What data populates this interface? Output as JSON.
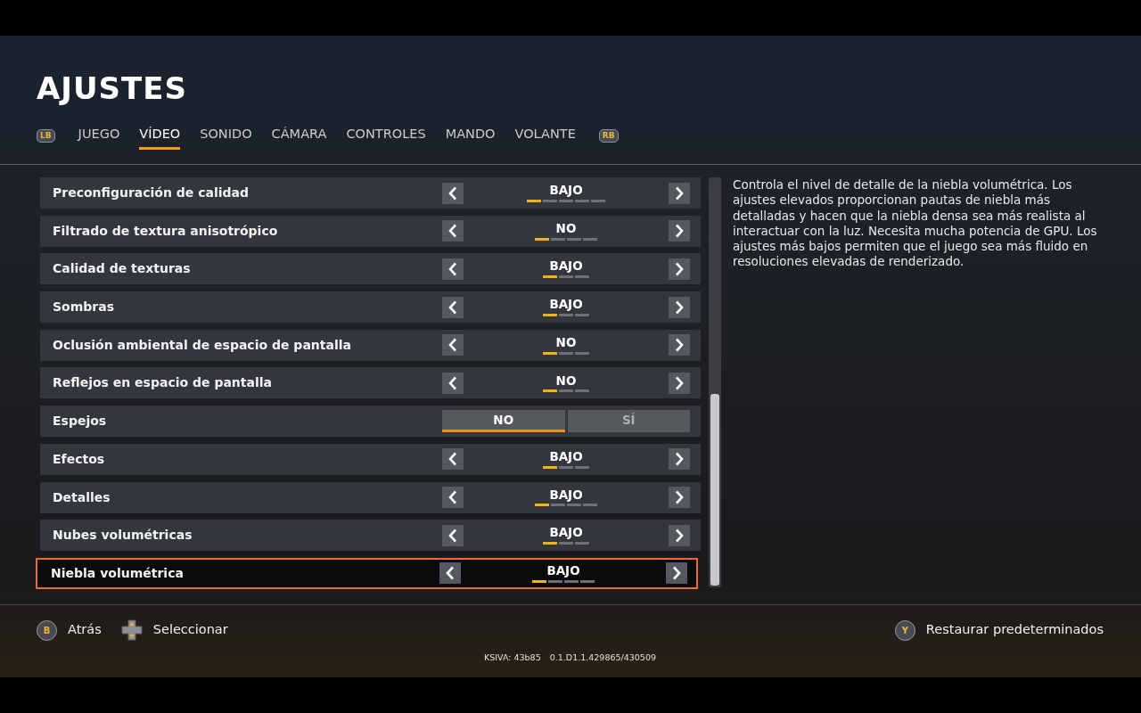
{
  "title": "AJUSTES",
  "tabs": [
    {
      "label": "JUEGO",
      "selected": false
    },
    {
      "label": "VÍDEO",
      "selected": true
    },
    {
      "label": "SONIDO",
      "selected": false
    },
    {
      "label": "CÁMARA",
      "selected": false
    },
    {
      "label": "CONTROLES",
      "selected": false
    },
    {
      "label": "MANDO",
      "selected": false
    },
    {
      "label": "VOLANTE",
      "selected": false
    }
  ],
  "bumpers": [
    "LB",
    "RB"
  ],
  "settings": [
    {
      "kind": "selector",
      "label": "Preconfiguración de calidad",
      "value": "BAJO",
      "focused": false,
      "steps": [
        {
          "selected": true
        },
        {
          "selected": false
        },
        {
          "selected": false
        },
        {
          "selected": false
        },
        {
          "selected": false
        }
      ]
    },
    {
      "kind": "selector",
      "label": "Filtrado de textura anisotrópico",
      "value": "NO",
      "focused": false,
      "steps": [
        {
          "selected": true
        },
        {
          "selected": false
        },
        {
          "selected": false
        },
        {
          "selected": false
        }
      ]
    },
    {
      "kind": "selector",
      "label": "Calidad de texturas",
      "value": "BAJO",
      "focused": false,
      "steps": [
        {
          "selected": true
        },
        {
          "selected": false
        },
        {
          "selected": false
        }
      ]
    },
    {
      "kind": "selector",
      "label": "Sombras",
      "value": "BAJO",
      "focused": false,
      "steps": [
        {
          "selected": true
        },
        {
          "selected": false
        },
        {
          "selected": false
        }
      ]
    },
    {
      "kind": "selector",
      "label": "Oclusión ambiental de espacio de pantalla",
      "value": "NO",
      "focused": false,
      "steps": [
        {
          "selected": true
        },
        {
          "selected": false
        },
        {
          "selected": false
        }
      ]
    },
    {
      "kind": "selector",
      "label": "Reflejos en espacio de pantalla",
      "value": "NO",
      "focused": false,
      "steps": [
        {
          "selected": true
        },
        {
          "selected": false
        },
        {
          "selected": false
        }
      ]
    },
    {
      "kind": "toggle",
      "label": "Espejos",
      "focused": false,
      "options": [
        {
          "label": "NO",
          "selected": true
        },
        {
          "label": "SÍ",
          "selected": false
        }
      ]
    },
    {
      "kind": "selector",
      "label": "Efectos",
      "value": "BAJO",
      "focused": false,
      "steps": [
        {
          "selected": true
        },
        {
          "selected": false
        },
        {
          "selected": false
        }
      ]
    },
    {
      "kind": "selector",
      "label": "Detalles",
      "value": "BAJO",
      "focused": false,
      "steps": [
        {
          "selected": true
        },
        {
          "selected": false
        },
        {
          "selected": false
        },
        {
          "selected": false
        }
      ]
    },
    {
      "kind": "selector",
      "label": "Nubes volumétricas",
      "value": "BAJO",
      "focused": false,
      "steps": [
        {
          "selected": true
        },
        {
          "selected": false
        },
        {
          "selected": false
        }
      ]
    },
    {
      "kind": "selector",
      "label": "Niebla volumétrica",
      "value": "BAJO",
      "focused": true,
      "steps": [
        {
          "selected": true
        },
        {
          "selected": false
        },
        {
          "selected": false
        },
        {
          "selected": false
        }
      ]
    }
  ],
  "description": "Controla el nivel de detalle de la niebla volumétrica. Los ajustes elevados proporcionan pautas de niebla más detalladas y hacen que la niebla densa sea más realista al interactuar con la luz. Necesita mucha potencia de GPU. Los ajustes más bajos permiten que el juego sea más fluido en resoluciones elevadas de renderizado.",
  "footer": {
    "left": [
      {
        "kind": "button",
        "key": "B",
        "label": "Atrás"
      },
      {
        "kind": "dpad",
        "label": "Seleccionar"
      }
    ],
    "right": [
      {
        "kind": "button",
        "key": "Y",
        "label": "Restaurar predeterminados"
      }
    ],
    "version": [
      "KSIVA: 43b85",
      "0.1.D1.1.429865/430509"
    ]
  }
}
